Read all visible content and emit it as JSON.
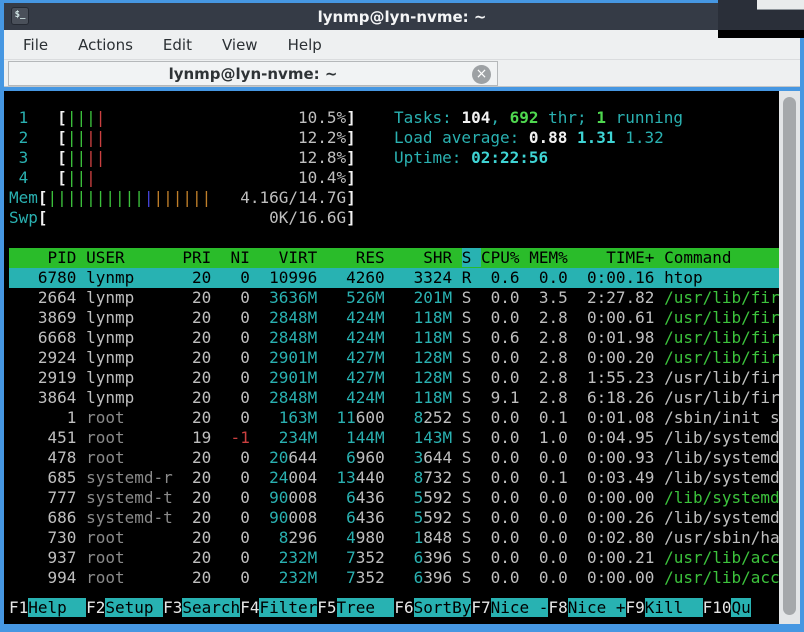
{
  "window": {
    "title": "lynmp@lyn-nvme: ~",
    "icon_glyph": "$_"
  },
  "colors": {
    "window_border": "#4697e2",
    "titlebar_bg": "#353b46",
    "header_row_bg": "#2abc2a",
    "selection_bg": "#28b2b2",
    "terminal_bg": "#000000"
  },
  "menu": {
    "items": [
      "File",
      "Actions",
      "Edit",
      "View",
      "Help"
    ]
  },
  "tab": {
    "title": "lynmp@lyn-nvme: ~",
    "close_icon": "×"
  },
  "htop": {
    "meters": {
      "cpus": [
        {
          "label": "1",
          "value": "10.5%",
          "bars": [
            {
              "text": "|||",
              "color": "green"
            },
            {
              "text": "|",
              "color": "red"
            }
          ]
        },
        {
          "label": "2",
          "value": "12.2%",
          "bars": [
            {
              "text": "||",
              "color": "green"
            },
            {
              "text": "||",
              "color": "red"
            }
          ]
        },
        {
          "label": "3",
          "value": "12.8%",
          "bars": [
            {
              "text": "||",
              "color": "green"
            },
            {
              "text": "||",
              "color": "red"
            }
          ]
        },
        {
          "label": "4",
          "value": "10.4%",
          "bars": [
            {
              "text": "||",
              "color": "green"
            },
            {
              "text": "|",
              "color": "red"
            }
          ]
        }
      ],
      "mem": {
        "label": "Mem",
        "value": "4.16G/14.7G",
        "bars": [
          {
            "text": "||||||||||",
            "color": "green"
          },
          {
            "text": "|",
            "color": "blue"
          },
          {
            "text": "||||||",
            "color": "orange"
          }
        ]
      },
      "swp": {
        "label": "Swp",
        "value": "0K/16.6G",
        "bars": []
      }
    },
    "info_lines": [
      {
        "name": "tasks",
        "segs": [
          [
            "Tasks: ",
            "cyan"
          ],
          [
            "104",
            "bwhite"
          ],
          [
            ", ",
            "cyan"
          ],
          [
            "692",
            "bgreen"
          ],
          [
            " thr; ",
            "cyan"
          ],
          [
            "1",
            "bgreen"
          ],
          [
            " running",
            "cyan"
          ]
        ]
      },
      {
        "name": "load-average",
        "segs": [
          [
            "Load average: ",
            "cyan"
          ],
          [
            "0.88 ",
            "bwhite"
          ],
          [
            "1.31 ",
            "bcyan"
          ],
          [
            "1.32",
            "cyan"
          ]
        ]
      },
      {
        "name": "uptime",
        "segs": [
          [
            "Uptime: ",
            "cyan"
          ],
          [
            "02:22:56",
            "bcyan"
          ]
        ]
      }
    ],
    "table": {
      "columns": [
        "PID",
        "USER",
        "PRI",
        "NI",
        "VIRT",
        "RES",
        "SHR",
        "S",
        "CPU%",
        "MEM%",
        "TIME+",
        "Command"
      ],
      "sort_column": "S",
      "rows": [
        {
          "pid": "6780",
          "user": "lynmp",
          "pri": "20",
          "ni": "0",
          "virt": "10996",
          "res": "4260",
          "shr": "3324",
          "s": "R",
          "cpu": "0.6",
          "mem": "0.0",
          "time": "0:00.16",
          "cmd": "htop",
          "selected": true,
          "thread": false
        },
        {
          "pid": "2664",
          "user": "lynmp",
          "pri": "20",
          "ni": "0",
          "virt": "3636M",
          "res": "526M",
          "shr": "201M",
          "s": "S",
          "cpu": "0.0",
          "mem": "3.5",
          "time": "2:27.82",
          "cmd": "/usr/lib/fir",
          "selected": false,
          "thread": true
        },
        {
          "pid": "3869",
          "user": "lynmp",
          "pri": "20",
          "ni": "0",
          "virt": "2848M",
          "res": "424M",
          "shr": "118M",
          "s": "S",
          "cpu": "0.0",
          "mem": "2.8",
          "time": "0:00.61",
          "cmd": "/usr/lib/fir",
          "selected": false,
          "thread": true
        },
        {
          "pid": "6668",
          "user": "lynmp",
          "pri": "20",
          "ni": "0",
          "virt": "2848M",
          "res": "424M",
          "shr": "118M",
          "s": "S",
          "cpu": "0.6",
          "mem": "2.8",
          "time": "0:01.98",
          "cmd": "/usr/lib/fir",
          "selected": false,
          "thread": true
        },
        {
          "pid": "2924",
          "user": "lynmp",
          "pri": "20",
          "ni": "0",
          "virt": "2901M",
          "res": "427M",
          "shr": "128M",
          "s": "S",
          "cpu": "0.0",
          "mem": "2.8",
          "time": "0:00.20",
          "cmd": "/usr/lib/fir",
          "selected": false,
          "thread": true
        },
        {
          "pid": "2919",
          "user": "lynmp",
          "pri": "20",
          "ni": "0",
          "virt": "2901M",
          "res": "427M",
          "shr": "128M",
          "s": "S",
          "cpu": "0.0",
          "mem": "2.8",
          "time": "1:55.23",
          "cmd": "/usr/lib/fir",
          "selected": false,
          "thread": false
        },
        {
          "pid": "3864",
          "user": "lynmp",
          "pri": "20",
          "ni": "0",
          "virt": "2848M",
          "res": "424M",
          "shr": "118M",
          "s": "S",
          "cpu": "9.1",
          "mem": "2.8",
          "time": "6:18.26",
          "cmd": "/usr/lib/fir",
          "selected": false,
          "thread": false
        },
        {
          "pid": "1",
          "user": "root",
          "pri": "20",
          "ni": "0",
          "virt": "163M",
          "res": "11600",
          "shr": "8252",
          "s": "S",
          "cpu": "0.0",
          "mem": "0.1",
          "time": "0:01.08",
          "cmd": "/sbin/init s",
          "selected": false,
          "thread": false
        },
        {
          "pid": "451",
          "user": "root",
          "pri": "19",
          "ni": "-1",
          "virt": "234M",
          "res": "144M",
          "shr": "143M",
          "s": "S",
          "cpu": "0.0",
          "mem": "1.0",
          "time": "0:04.95",
          "cmd": "/lib/systemd",
          "selected": false,
          "thread": false
        },
        {
          "pid": "478",
          "user": "root",
          "pri": "20",
          "ni": "0",
          "virt": "20644",
          "res": "6960",
          "shr": "3644",
          "s": "S",
          "cpu": "0.0",
          "mem": "0.0",
          "time": "0:00.93",
          "cmd": "/lib/systemd",
          "selected": false,
          "thread": false
        },
        {
          "pid": "685",
          "user": "systemd-r",
          "pri": "20",
          "ni": "0",
          "virt": "24004",
          "res": "13440",
          "shr": "8732",
          "s": "S",
          "cpu": "0.0",
          "mem": "0.1",
          "time": "0:03.49",
          "cmd": "/lib/systemd",
          "selected": false,
          "thread": false
        },
        {
          "pid": "777",
          "user": "systemd-t",
          "pri": "20",
          "ni": "0",
          "virt": "90008",
          "res": "6436",
          "shr": "5592",
          "s": "S",
          "cpu": "0.0",
          "mem": "0.0",
          "time": "0:00.00",
          "cmd": "/lib/systemd",
          "selected": false,
          "thread": true
        },
        {
          "pid": "686",
          "user": "systemd-t",
          "pri": "20",
          "ni": "0",
          "virt": "90008",
          "res": "6436",
          "shr": "5592",
          "s": "S",
          "cpu": "0.0",
          "mem": "0.0",
          "time": "0:00.26",
          "cmd": "/lib/systemd",
          "selected": false,
          "thread": false
        },
        {
          "pid": "730",
          "user": "root",
          "pri": "20",
          "ni": "0",
          "virt": "8296",
          "res": "4980",
          "shr": "1848",
          "s": "S",
          "cpu": "0.0",
          "mem": "0.0",
          "time": "0:02.80",
          "cmd": "/usr/sbin/ha",
          "selected": false,
          "thread": false
        },
        {
          "pid": "937",
          "user": "root",
          "pri": "20",
          "ni": "0",
          "virt": "232M",
          "res": "7352",
          "shr": "6396",
          "s": "S",
          "cpu": "0.0",
          "mem": "0.0",
          "time": "0:00.21",
          "cmd": "/usr/lib/acc",
          "selected": false,
          "thread": true
        },
        {
          "pid": "994",
          "user": "root",
          "pri": "20",
          "ni": "0",
          "virt": "232M",
          "res": "7352",
          "shr": "6396",
          "s": "S",
          "cpu": "0.0",
          "mem": "0.0",
          "time": "0:00.00",
          "cmd": "/usr/lib/acc",
          "selected": false,
          "thread": true
        }
      ]
    },
    "fkeys": [
      {
        "key": "F1",
        "label": "Help  "
      },
      {
        "key": "F2",
        "label": "Setup "
      },
      {
        "key": "F3",
        "label": "Search"
      },
      {
        "key": "F4",
        "label": "Filter"
      },
      {
        "key": "F5",
        "label": "Tree  "
      },
      {
        "key": "F6",
        "label": "SortBy"
      },
      {
        "key": "F7",
        "label": "Nice -"
      },
      {
        "key": "F8",
        "label": "Nice +"
      },
      {
        "key": "F9",
        "label": "Kill  "
      },
      {
        "key": "F10",
        "label": "Qu"
      }
    ]
  }
}
